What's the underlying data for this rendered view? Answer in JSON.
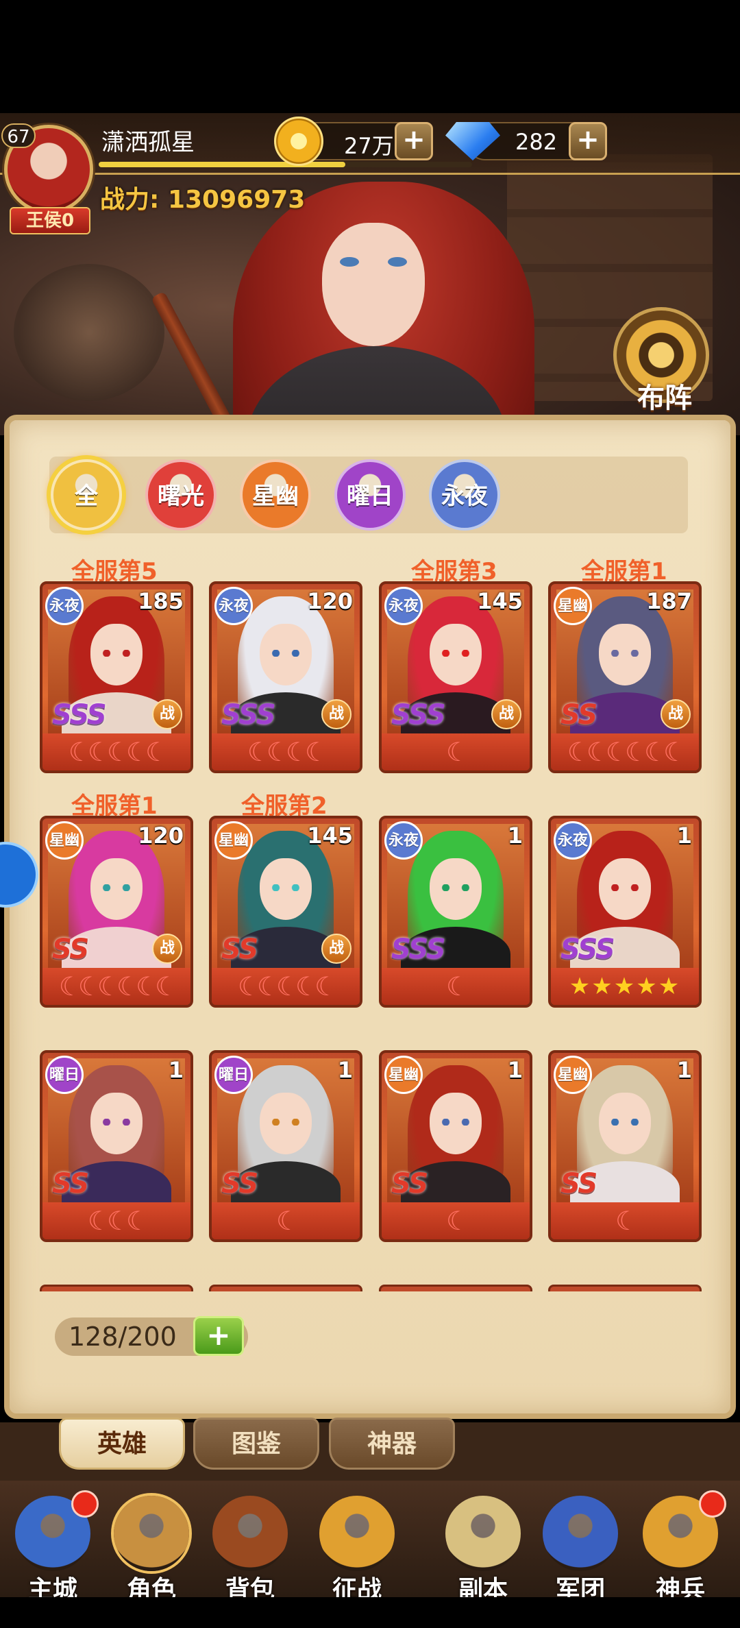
{
  "player": {
    "level": "67",
    "name": "潇洒孤星",
    "rank": "王侯0",
    "power_label": "战力:",
    "power_value": "13096973",
    "exp_fraction": 0.66
  },
  "currency": {
    "gold": "27万",
    "gems": "282"
  },
  "formation_label": "布阵",
  "filters": [
    {
      "label": "全",
      "color": "#f0c040",
      "selected": true
    },
    {
      "label": "曙光",
      "color": "#e0403a",
      "selected": false
    },
    {
      "label": "星幽",
      "color": "#ea7a2a",
      "selected": false
    },
    {
      "label": "曜日",
      "color": "#a044c8",
      "selected": false
    },
    {
      "label": "永夜",
      "color": "#5a7ad0",
      "selected": false
    }
  ],
  "rank_tags": [
    "全服第5",
    "全服第3",
    "全服第1",
    "全服第1",
    "全服第2"
  ],
  "heroes": [
    {
      "faction": "永夜",
      "level": "185",
      "grade": "SSS",
      "role": "战",
      "stars": "☾☾☾☾☾",
      "hair": "#b8221a",
      "eye": "#c02020",
      "body": "#e9d5c8"
    },
    {
      "faction": "永夜",
      "level": "120",
      "grade": "SSS",
      "role": "战",
      "stars": "☾☾☾☾",
      "hair": "#e8e8ee",
      "eye": "#3a6ab0",
      "body": "#2a2a2a"
    },
    {
      "faction": "永夜",
      "level": "145",
      "grade": "SSS",
      "role": "战",
      "stars": "☾",
      "hair": "#d8283a",
      "eye": "#e02020",
      "body": "#2a1a20"
    },
    {
      "faction": "星幽",
      "level": "187",
      "grade": "SS",
      "role": "战",
      "stars": "☾☾☾☾☾☾",
      "hair": "#5a5a80",
      "eye": "#6a6aa0",
      "body": "#5a2a7a"
    },
    {
      "faction": "星幽",
      "level": "120",
      "grade": "SS",
      "role": "战",
      "stars": "☾☾☾☾☾☾",
      "hair": "#d83aa0",
      "eye": "#30a0a0",
      "body": "#f0d0d0"
    },
    {
      "faction": "星幽",
      "level": "145",
      "grade": "SS",
      "role": "战",
      "stars": "☾☾☾☾☾",
      "hair": "#2a7070",
      "eye": "#40c0c0",
      "body": "#2a2a3a"
    },
    {
      "faction": "永夜",
      "level": "1",
      "grade": "SSS",
      "role": "",
      "stars": "☾",
      "hair": "#3ac040",
      "eye": "#20a060",
      "body": "#1a1a1a"
    },
    {
      "faction": "永夜",
      "level": "1",
      "grade": "SSS",
      "role": "",
      "stars": "★★★★★",
      "hair": "#b8221a",
      "eye": "#c02020",
      "body": "#e9d5c8"
    },
    {
      "faction": "曜日",
      "level": "1",
      "grade": "SS",
      "role": "",
      "stars": "☾☾☾",
      "hair": "#a8524a",
      "eye": "#8a3aa0",
      "body": "#3a2a5a"
    },
    {
      "faction": "曜日",
      "level": "1",
      "grade": "SS",
      "role": "",
      "stars": "☾",
      "hair": "#cfcfcf",
      "eye": "#d08020",
      "body": "#2a2a2a"
    },
    {
      "faction": "星幽",
      "level": "1",
      "grade": "SS",
      "role": "",
      "stars": "☾",
      "hair": "#b02a1a",
      "eye": "#4a6ab0",
      "body": "#2a2224"
    },
    {
      "faction": "星幽",
      "level": "1",
      "grade": "SS",
      "role": "",
      "stars": "☾",
      "hair": "#d8c8a8",
      "eye": "#3a70b0",
      "body": "#e8e0e0"
    }
  ],
  "capacity": "128/200",
  "tabs": [
    {
      "label": "英雄",
      "active": true
    },
    {
      "label": "图鉴",
      "active": false
    },
    {
      "label": "神器",
      "active": false
    }
  ],
  "nav": [
    {
      "label": "主城",
      "icon": "castle-icon",
      "color": "#3a6ac8",
      "badge": true
    },
    {
      "label": "角色",
      "icon": "character-icon",
      "color": "#c89040",
      "badge": false
    },
    {
      "label": "背包",
      "icon": "backpack-icon",
      "color": "#9a4a20",
      "badge": false
    },
    {
      "label": "征战",
      "icon": "battle-icon",
      "color": "#e0a030",
      "badge": false
    },
    {
      "label": "副本",
      "icon": "scroll-icon",
      "color": "#d8c080",
      "badge": false
    },
    {
      "label": "军团",
      "icon": "legion-icon",
      "color": "#3a60c0",
      "badge": false
    },
    {
      "label": "神兵",
      "icon": "hammer-icon",
      "color": "#e0a030",
      "badge": true
    }
  ]
}
